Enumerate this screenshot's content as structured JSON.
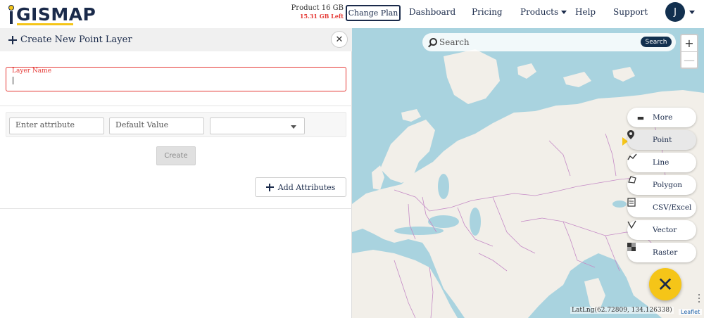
{
  "header": {
    "logo_text": "GISMAP",
    "logo_prefix": "i",
    "storage_plan": "Product 16 GB",
    "storage_left": "15.31 GB Left",
    "change_plan_label": "Change Plan",
    "nav": {
      "dashboard": "Dashboard",
      "pricing": "Pricing",
      "products": "Products",
      "help": "Help",
      "support": "Support"
    },
    "user_initial": "J"
  },
  "panel": {
    "title": "Create New Point Layer",
    "close_symbol": "✕",
    "layer_name_label": "Layer Name",
    "attribute_placeholder": "Enter attribute",
    "default_value_placeholder": "Default Value",
    "type_select_value": "",
    "create_label": "Create",
    "add_attributes_label": "Add Attributes"
  },
  "map": {
    "search_placeholder": "Search",
    "search_button": "Search",
    "zoom_in": "+",
    "zoom_out": "—",
    "menu": {
      "more": "More",
      "point": "Point",
      "line": "Line",
      "polygon": "Polygon",
      "csv": "CSV/Excel",
      "vector": "Vector",
      "raster": "Raster"
    },
    "active_tool": "Point",
    "fab_symbol": "✕",
    "latlng": "LatLng(62.72809, 134.126338)",
    "attribution": "Leaflet"
  },
  "colors": {
    "brand_navy": "#12304f",
    "accent_yellow": "#f5c518",
    "error_red": "#e53935",
    "water": "#a9d3df",
    "land": "#f2efe9",
    "border": "#c58bc6"
  },
  "icons": {
    "more": "more-icon",
    "point": "map-marker-icon",
    "line": "polyline-icon",
    "polygon": "polygon-icon",
    "csv": "csv-file-icon",
    "vector": "vector-icon",
    "raster": "raster-grid-icon"
  }
}
